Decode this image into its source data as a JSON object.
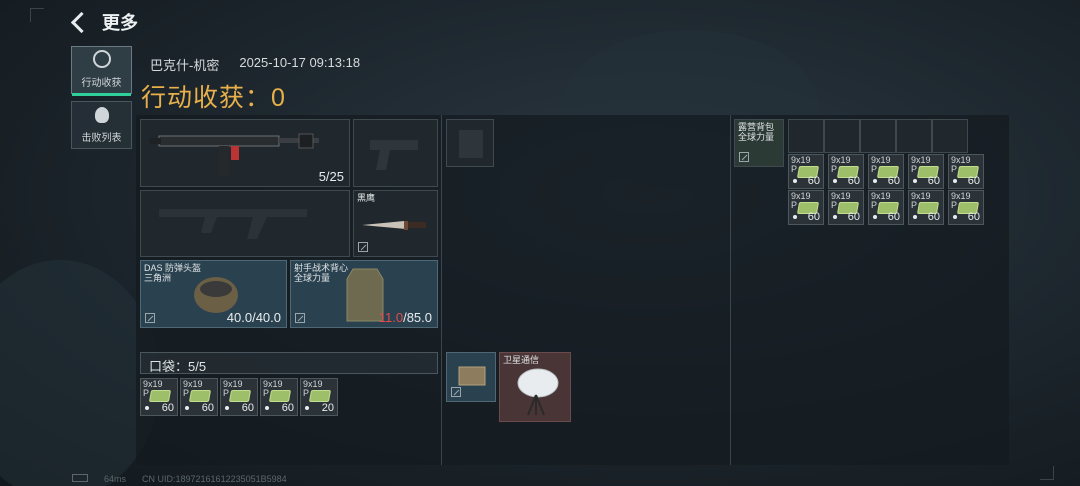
{
  "header": {
    "title": "更多"
  },
  "sidebar": [
    {
      "label": "行动收获",
      "icon": "target-icon",
      "active": true
    },
    {
      "label": "击败列表",
      "icon": "skull-icon",
      "active": false
    }
  ],
  "meta": {
    "map": "巴克什-机密",
    "datetime": "2025-10-17 09:13:18"
  },
  "harvest": {
    "text": "行动收获：0"
  },
  "loadout": {
    "primary": {
      "count": "5/25"
    },
    "melee": {
      "name": "黑鹰"
    },
    "helmet": {
      "name": "DAS 防弹头盔",
      "brand": "三角洲",
      "durability": "40.0/40.0"
    },
    "armor": {
      "name": "射手战术背心",
      "brand": "全球力量",
      "durability_current": "11.0",
      "durability_max": "/85.0"
    },
    "pocket": {
      "label": "口袋：5/5"
    },
    "pocket_ammo": [
      {
        "type": "9x19\nP",
        "count": "60"
      },
      {
        "type": "9x19\nP",
        "count": "60"
      },
      {
        "type": "9x19\nP",
        "count": "60"
      },
      {
        "type": "9x19\nP",
        "count": "60"
      },
      {
        "type": "9x19\nP",
        "count": "20"
      }
    ],
    "satellite": {
      "name": "卫星通信"
    },
    "backpack": {
      "name": "露营背包",
      "brand": "全球力量"
    },
    "backpack_ammo": [
      {
        "type": "9x19\nP",
        "count": "60"
      },
      {
        "type": "9x19\nP",
        "count": "60"
      },
      {
        "type": "9x19\nP",
        "count": "60"
      },
      {
        "type": "9x19\nP",
        "count": "60"
      },
      {
        "type": "9x19\nP",
        "count": "60"
      },
      {
        "type": "9x19\nP",
        "count": "60"
      },
      {
        "type": "9x19\nP",
        "count": "60"
      },
      {
        "type": "9x19\nP",
        "count": "60"
      },
      {
        "type": "9x19\nP",
        "count": "60"
      },
      {
        "type": "9x19\nP",
        "count": "60"
      }
    ]
  },
  "footer": {
    "ping": "64ms",
    "uid": "CN UID:18972161612235051B5984"
  },
  "colors": {
    "accent_gold": "#e8b04a",
    "active_tab": "#2fcf9a",
    "low_durability": "#e24b4b"
  }
}
